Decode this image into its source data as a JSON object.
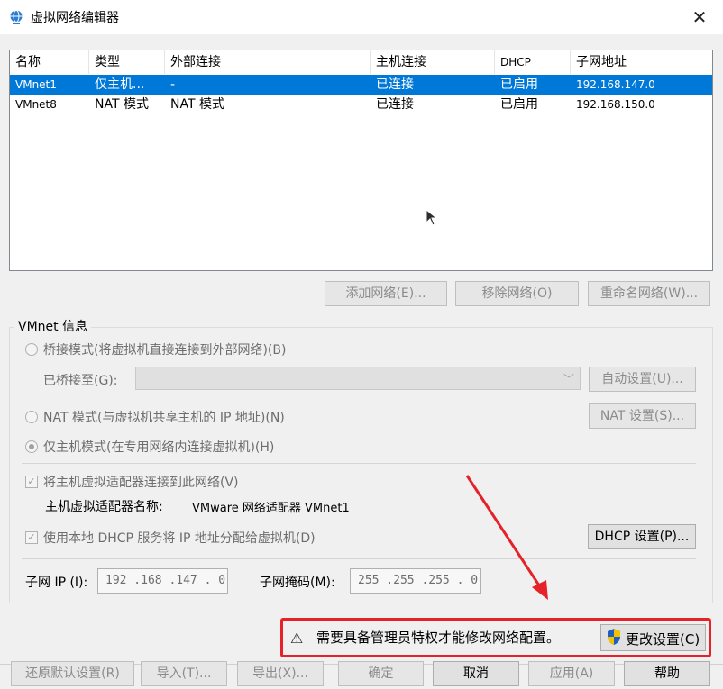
{
  "window": {
    "title": "虚拟网络编辑器",
    "close_icon": "close-icon",
    "app_icon": "network-globe-icon"
  },
  "list": {
    "columns": [
      "名称",
      "类型",
      "外部连接",
      "主机连接",
      "DHCP",
      "子网地址"
    ],
    "rows": [
      {
        "name": "VMnet1",
        "type": "仅主机...",
        "external": "-",
        "host": "已连接",
        "dhcp": "已启用",
        "subnet": "192.168.147.0",
        "selected": true
      },
      {
        "name": "VMnet8",
        "type": "NAT 模式",
        "external": "NAT 模式",
        "host": "已连接",
        "dhcp": "已启用",
        "subnet": "192.168.150.0",
        "selected": false
      }
    ]
  },
  "list_buttons": {
    "add": "添加网络(E)...",
    "remove": "移除网络(O)",
    "rename": "重命名网络(W)..."
  },
  "vmnet_info": {
    "title": "VMnet 信息",
    "bridged_mode": "桥接模式(将虚拟机直接连接到外部网络)(B)",
    "bridged_to_label": "已桥接至(G):",
    "bridged_to_value": "",
    "auto_settings": "自动设置(U)...",
    "nat_mode": "NAT 模式(与虚拟机共享主机的 IP 地址)(N)",
    "nat_settings": "NAT 设置(S)...",
    "host_only_mode": "仅主机模式(在专用网络内连接虚拟机)(H)",
    "connect_adapter": "将主机虚拟适配器连接到此网络(V)",
    "adapter_name_label": "主机虚拟适配器名称:",
    "adapter_name_value": "VMware 网络适配器 VMnet1",
    "use_dhcp": "使用本地 DHCP 服务将 IP 地址分配给虚拟机(D)",
    "dhcp_settings": "DHCP 设置(P)...",
    "subnet_ip_label": "子网 IP (I):",
    "subnet_ip_value": "192 .168 .147 .  0",
    "subnet_mask_label": "子网掩码(M):",
    "subnet_mask_value": "255 .255 .255 .  0"
  },
  "warning": {
    "icon": "warning-icon",
    "text": "需要具备管理员特权才能修改网络配置。",
    "change_button": "更改设置(C)",
    "shield_icon": "uac-shield-icon"
  },
  "footer": {
    "restore": "还原默认设置(R)",
    "import": "导入(T)...",
    "export": "导出(X)...",
    "ok": "确定",
    "cancel": "取消",
    "apply": "应用(A)",
    "help": "帮助"
  },
  "colors": {
    "selection": "#0078d7",
    "annotation_red": "#e5222a"
  }
}
